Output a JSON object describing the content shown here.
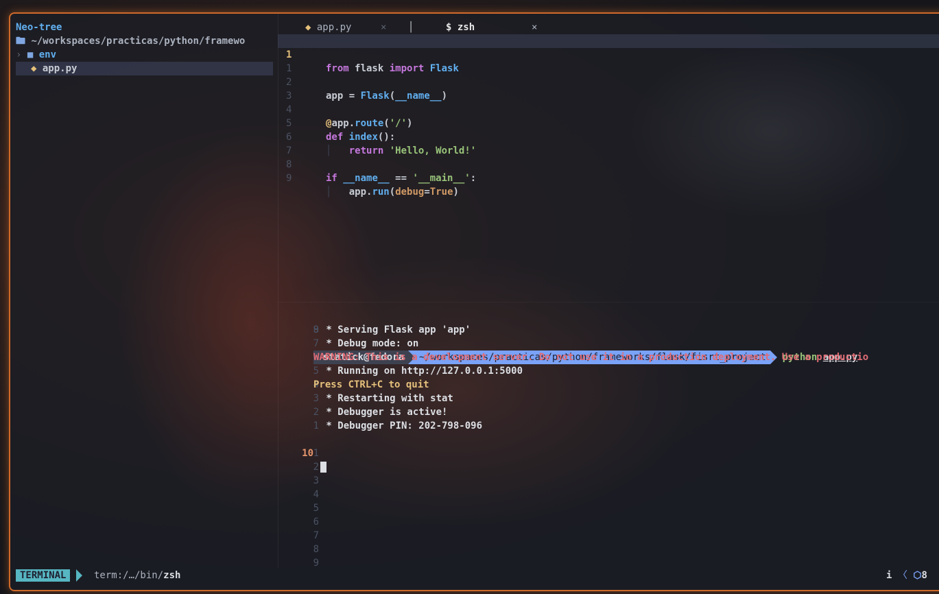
{
  "sidebar": {
    "title": "Neo-tree",
    "root": "~/workspaces/practicas/python/framewo",
    "items": [
      {
        "label": "env",
        "icon": "folder-icon",
        "expandable": true
      },
      {
        "label": "app.py",
        "icon": "python-icon",
        "selected": true
      }
    ]
  },
  "tabs": [
    {
      "label": "app.py",
      "close": "×"
    },
    {
      "label": "$ zsh",
      "close": "×"
    }
  ],
  "editor": {
    "lines": [
      {
        "n": "1"
      },
      {
        "n": "1"
      },
      {
        "n": "2"
      },
      {
        "n": "3"
      },
      {
        "n": "4"
      },
      {
        "n": "5"
      },
      {
        "n": "6"
      },
      {
        "n": "7"
      },
      {
        "n": "8"
      },
      {
        "n": "9"
      }
    ]
  },
  "terminal": {
    "prompt_line_number": "9",
    "prompt_user": "statick@fedora",
    "prompt_path": "~/workspaces/practicas/python/frameworks/flask/fisrt_project",
    "prompt_cmd": "python",
    "prompt_arg": "app.py",
    "output": [
      {
        "n": "8",
        "text": " * Serving Flask app 'app'",
        "style": "normal"
      },
      {
        "n": "7",
        "text": " * Debug mode: on",
        "style": "normal"
      },
      {
        "n": "6",
        "text": "WARNING: This is a development server. Do not use it in a production deployment. Use a productio",
        "style": "warn"
      },
      {
        "n": "5",
        "text": " * Running on http://127.0.0.1:5000",
        "style": "normal"
      },
      {
        "n": "4",
        "text": "Press CTRL+C to quit",
        "style": "yellow"
      },
      {
        "n": "3",
        "text": " * Restarting with stat",
        "style": "normal"
      },
      {
        "n": "2",
        "text": " * Debugger is active!",
        "style": "normal"
      },
      {
        "n": "1",
        "text": " * Debugger PIN: 202-798-096",
        "style": "normal"
      }
    ],
    "current_line": "10",
    "after_lines": [
      "1",
      "2",
      "3",
      "4",
      "5",
      "6",
      "7",
      "8",
      "9"
    ]
  },
  "statusbar": {
    "mode": "TERMINAL",
    "file_prefix": "term:/…/bin/",
    "file_name": "zsh",
    "right_mode": "i",
    "right_sep": "〈",
    "right_num": "8"
  },
  "colors": {
    "border_accent": "#d06a2a",
    "keyword": "#c678dd",
    "function": "#61afef",
    "string": "#98c379",
    "warning": "#e06c75",
    "mode_bg": "#56b6c2",
    "prompt_path_bg": "#7aa2f7"
  }
}
